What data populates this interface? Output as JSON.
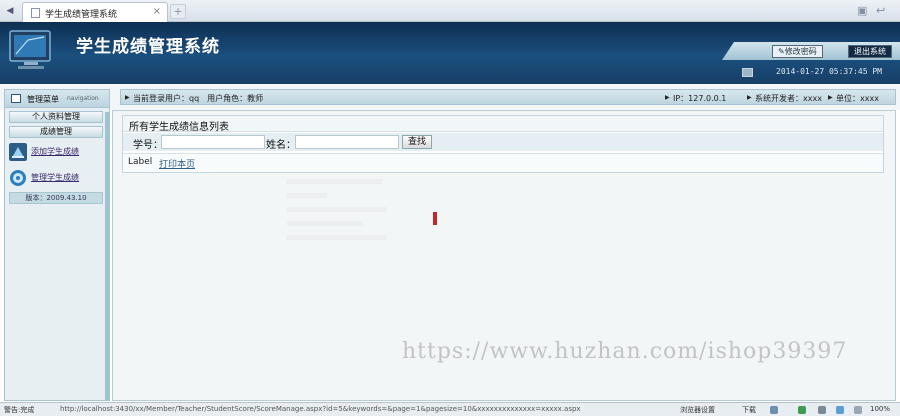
{
  "browser": {
    "tab_title": "学生成绩管理系统",
    "tab_close": "×",
    "new_tab": "+"
  },
  "app": {
    "title": "学生成绩管理系统",
    "change_password": "✎修改密码",
    "exit": "退出系统",
    "datetime": "2014-01-27 05:37:45 PM"
  },
  "infobar": {
    "current_user": "当前登录用户：qq　用户角色：教师",
    "ip": "IP：127.0.0.1",
    "developer": "系统开发者：xxxx",
    "unit": "单位：xxxx"
  },
  "sidebar": {
    "menu_title": "管理菜单",
    "menu_sub": "navigation",
    "groups": [
      "个人资料管理",
      "成绩管理"
    ],
    "items": [
      "添加学生成绩",
      "管理学生成绩"
    ],
    "version": "版本：2009.43.10"
  },
  "main": {
    "panel_title": "所有学生成绩信息列表",
    "student_id_label": "学号：",
    "name_label": "姓名：",
    "search_button": "查找",
    "student_id_value": "",
    "name_value": "",
    "result_label": "Label",
    "print_link": "打印本页"
  },
  "watermark": "https://www.huzhan.com/ishop39397",
  "statusbar": {
    "left": "警告:完成",
    "url": "http://localhost:3430/xx/Member/Teacher/StudentScore/ScoreManage.aspx?id=5&keywords=&page=1&pagesize=10&xxxxxxxxxxxxxx=xxxxx.aspx",
    "browser_label": "浏览器设置",
    "download": "下载",
    "zoom": "100%"
  },
  "colors": {
    "header_dark": "#0e2f52",
    "accent_light": "#bfd6e0",
    "link": "#2f5c8a",
    "red_mark": "#c0282c"
  }
}
